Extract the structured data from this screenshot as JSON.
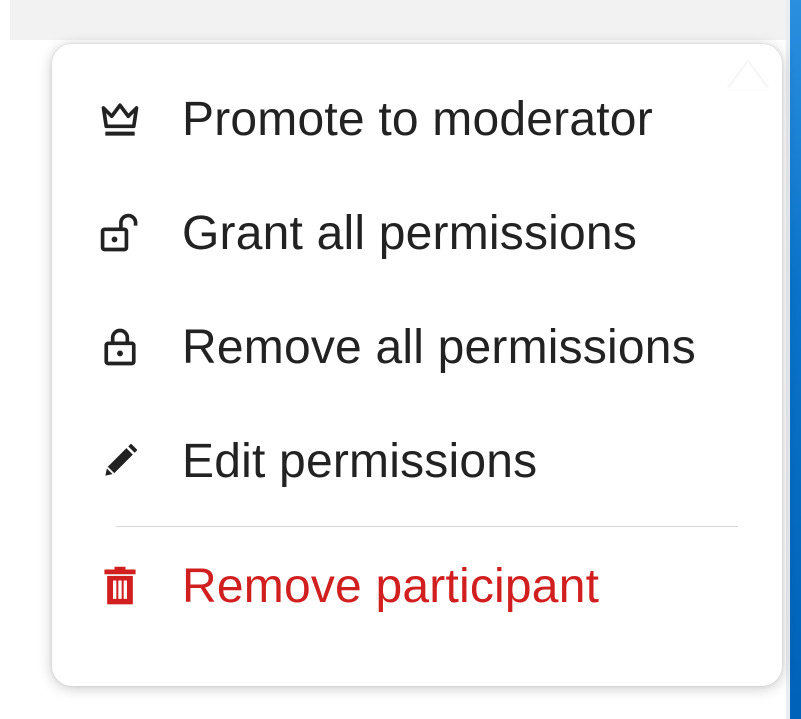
{
  "menu": {
    "items": [
      {
        "label": "Promote to moderator",
        "icon": "crown-icon"
      },
      {
        "label": "Grant all permissions",
        "icon": "lock-open-icon"
      },
      {
        "label": "Remove all permissions",
        "icon": "lock-icon"
      },
      {
        "label": "Edit permissions",
        "icon": "pencil-icon"
      }
    ],
    "danger_item": {
      "label": "Remove participant",
      "icon": "trash-icon"
    }
  },
  "colors": {
    "text": "#222222",
    "danger": "#d11f1f",
    "accent_bar": "#0a73c9"
  }
}
